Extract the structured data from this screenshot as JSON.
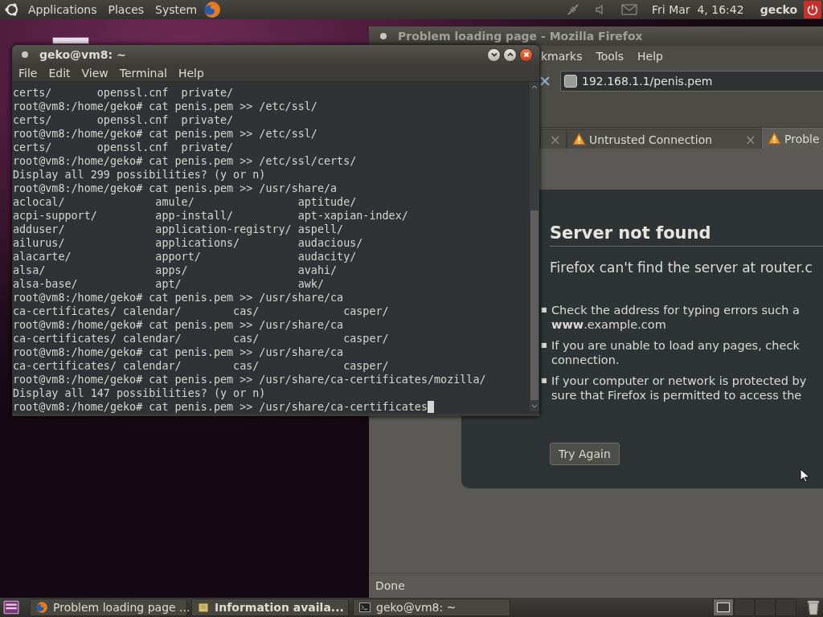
{
  "top_panel": {
    "menus": [
      "Applications",
      "Places",
      "System"
    ],
    "clock": "Fri Mar  4, 16:42",
    "user": "gecko"
  },
  "firefox": {
    "title": "Problem loading page - Mozilla Firefox",
    "menus": [
      "kmarks",
      "Tools",
      "Help"
    ],
    "url": "192.168.1.1/penis.pem",
    "tabs": [
      {
        "close": "×",
        "selected": false
      },
      {
        "label": "Untrusted Connection",
        "close": "×",
        "selected": false
      },
      {
        "label": "Proble",
        "selected": true
      }
    ],
    "error": {
      "heading": "Server not found",
      "message": "Firefox can't find the server at router.c",
      "bullets": [
        {
          "marker": "■",
          "lines": [
            "Check the address for typing errors such a",
            "**www**.example.com"
          ]
        },
        {
          "marker": "■",
          "lines": [
            "If you are unable to load any pages, check",
            "connection."
          ]
        },
        {
          "marker": "■",
          "lines": [
            "If your computer or network is protected by",
            "sure that Firefox is permitted to access the"
          ]
        }
      ],
      "button": "Try Again"
    },
    "status": "Done"
  },
  "terminal": {
    "title": "geko@vm8: ~",
    "menus": [
      "File",
      "Edit",
      "View",
      "Terminal",
      "Help"
    ],
    "lines": [
      "certs/       openssl.cnf  private/",
      "root@vm8:/home/geko# cat penis.pem >> /etc/ssl/",
      "certs/       openssl.cnf  private/",
      "root@vm8:/home/geko# cat penis.pem >> /etc/ssl/",
      "certs/       openssl.cnf  private/",
      "root@vm8:/home/geko# cat penis.pem >> /etc/ssl/certs/",
      "Display all 299 possibilities? (y or n)",
      "root@vm8:/home/geko# cat penis.pem >> /usr/share/a",
      "aclocal/              amule/                aptitude/",
      "acpi-support/         app-install/          apt-xapian-index/",
      "adduser/              application-registry/ aspell/",
      "ailurus/              applications/         audacious/",
      "alacarte/             apport/               audacity/",
      "alsa/                 apps/                 avahi/",
      "alsa-base/            apt/                  awk/",
      "root@vm8:/home/geko# cat penis.pem >> /usr/share/ca",
      "ca-certificates/ calendar/        cas/             casper/",
      "root@vm8:/home/geko# cat penis.pem >> /usr/share/ca",
      "ca-certificates/ calendar/        cas/             casper/",
      "root@vm8:/home/geko# cat penis.pem >> /usr/share/ca",
      "ca-certificates/ calendar/        cas/             casper/",
      "root@vm8:/home/geko# cat penis.pem >> /usr/share/ca-certificates/mozilla/",
      "Display all 147 possibilities? (y or n)",
      "root@vm8:/home/geko# cat penis.pem >> /usr/share/ca-certificates"
    ]
  },
  "taskbar": {
    "tasks": [
      {
        "label": "Problem loading page ...",
        "kind": "browser",
        "attention": false
      },
      {
        "label": "Information availa...",
        "kind": "notice",
        "attention": true
      },
      {
        "label": "geko@vm8: ~",
        "kind": "terminal",
        "attention": false
      }
    ],
    "workspaces": [
      {
        "selected": true
      },
      {
        "selected": false
      },
      {
        "selected": false
      },
      {
        "selected": false
      }
    ]
  }
}
